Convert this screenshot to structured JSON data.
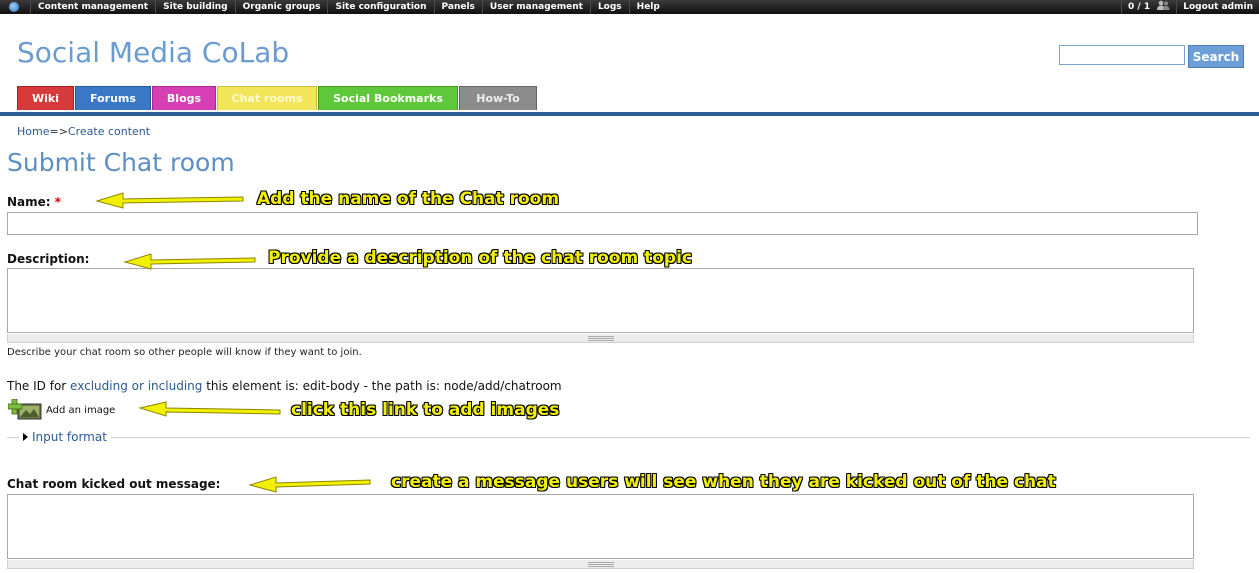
{
  "admin_bar": {
    "menu": [
      "Content management",
      "Site building",
      "Organic groups",
      "Site configuration",
      "Panels",
      "User management",
      "Logs",
      "Help"
    ],
    "user_count": "0 / 1",
    "logout": "Logout admin"
  },
  "header": {
    "site_name": "Social Media CoLab",
    "search_placeholder": "",
    "search_button": "Search"
  },
  "tabs": [
    {
      "label": "Wiki",
      "color": "#d63a3a"
    },
    {
      "label": "Forums",
      "color": "#3a78c6"
    },
    {
      "label": "Blogs",
      "color": "#d63fb5"
    },
    {
      "label": "Chat rooms",
      "color": "#f3e55a"
    },
    {
      "label": "Social Bookmarks",
      "color": "#5ec83a"
    },
    {
      "label": "How-To",
      "color": "#8c8c8c"
    }
  ],
  "breadcrumb": {
    "home": "Home",
    "separator": "=>",
    "current": "Create content"
  },
  "page_title": "Submit Chat room",
  "form": {
    "name_label": "Name:",
    "required_mark": "*",
    "name_value": "",
    "description_label": "Description:",
    "description_value": "",
    "description_help": "Describe your chat room so other people will know if they want to join.",
    "id_line_prefix": "The ID for ",
    "id_line_link": "excluding or including",
    "id_line_suffix": " this element is: edit-body - the path is: node/add/chatroom",
    "add_image": "Add an image",
    "input_format": "Input format",
    "kicked_label": "Chat room kicked out message:",
    "kicked_value": ""
  },
  "annotations": {
    "name": "Add the name of the Chat room",
    "description": "Provide a description of the chat room topic",
    "image": "click this link to add images",
    "kicked": "create a message users will see when they are kicked out of the chat"
  },
  "colors": {
    "link": "#2a5a8f",
    "title": "#5d8fc4",
    "annotation": "#f2f000",
    "bar": "#2f5e9a"
  }
}
